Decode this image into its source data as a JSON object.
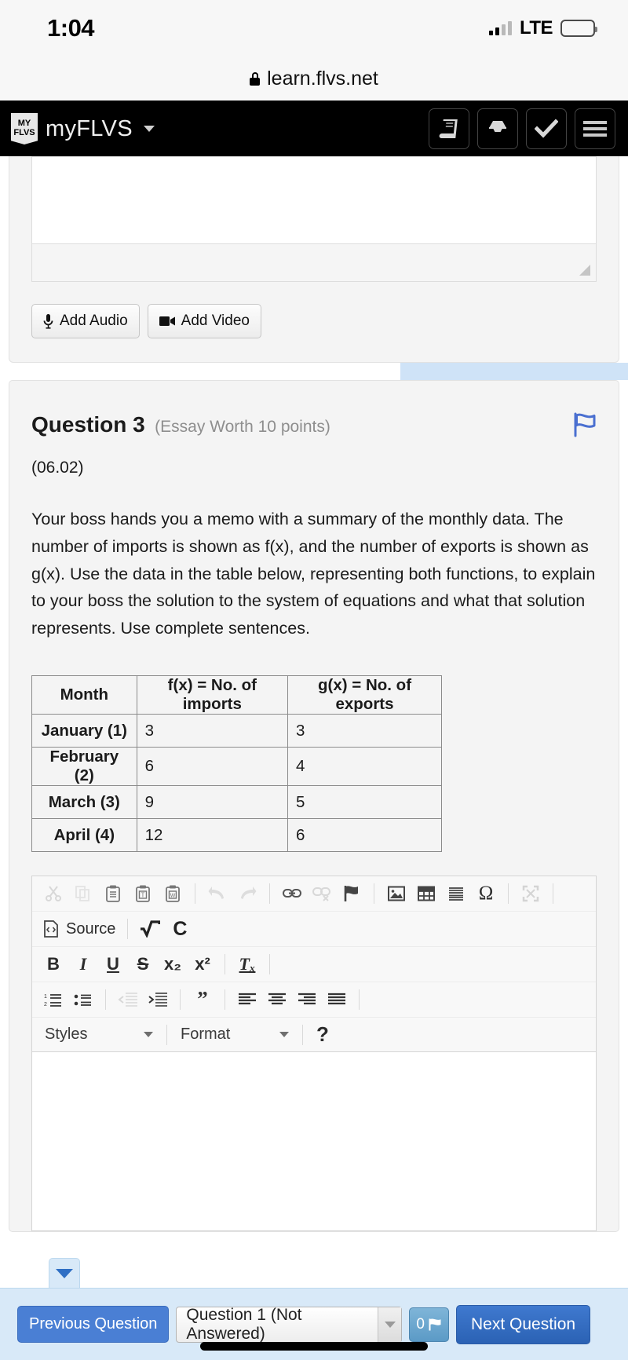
{
  "status_bar": {
    "time": "1:04",
    "network": "LTE",
    "signal_icon": "signal-bars-icon",
    "battery_icon": "battery-icon"
  },
  "browser": {
    "lock_icon": "lock-icon",
    "url": "learn.flvs.net"
  },
  "app_nav": {
    "logo_line1": "MY",
    "logo_line2": "FLVS",
    "brand": "myFLVS",
    "dropdown_icon": "chevron-down-icon",
    "icons": [
      {
        "name": "book-icon",
        "label": "Courses"
      },
      {
        "name": "inbox-icon",
        "label": "Messages"
      },
      {
        "name": "check-icon",
        "label": "Assignments"
      },
      {
        "name": "hamburger-menu-icon",
        "label": "Menu"
      }
    ]
  },
  "previous_question_card": {
    "answer_box_value": "",
    "add_audio_label": "Add Audio",
    "add_audio_icon": "microphone-icon",
    "add_video_label": "Add Video",
    "add_video_icon": "video-camera-icon",
    "resize_handle_icon": "resize-handle-icon"
  },
  "question": {
    "title": "Question 3",
    "worth": "(Essay Worth 10 points)",
    "code": "(06.02)",
    "flag_icon": "flag-icon",
    "prompt": "Your boss hands you a memo with a summary of the monthly data. The number of imports is shown as f(x), and the number of exports is shown as g(x). Use the data in the table below, representing both functions, to explain to your boss the solution to the system of equations and what that solution represents. Use complete sentences.",
    "table": {
      "headers": [
        "Month",
        "f(x) = No. of imports",
        "g(x) = No. of exports"
      ],
      "rows": [
        [
          "January (1)",
          "3",
          "3"
        ],
        [
          "February (2)",
          "6",
          "4"
        ],
        [
          "March (3)",
          "9",
          "5"
        ],
        [
          "April (4)",
          "12",
          "6"
        ]
      ]
    }
  },
  "editor": {
    "row1": [
      {
        "name": "cut-icon",
        "glyph": "✂",
        "state": "faded"
      },
      {
        "name": "copy-icon",
        "glyph": "❐",
        "state": "faded"
      },
      {
        "name": "paste-icon",
        "glyph": "ὌB",
        "state": "normal"
      },
      {
        "name": "paste-as-plain-text-icon",
        "glyph": "T",
        "state": "normal"
      },
      {
        "name": "paste-from-word-icon",
        "glyph": "W",
        "state": "normal"
      },
      {
        "name": "undo-icon",
        "glyph": "↶",
        "state": "faded"
      },
      {
        "name": "redo-icon",
        "glyph": "↷",
        "state": "faded"
      },
      {
        "name": "link-icon",
        "glyph": "ὑ7",
        "state": "normal"
      },
      {
        "name": "unlink-icon",
        "glyph": "ὑ7",
        "state": "faded"
      },
      {
        "name": "anchor-flag-icon",
        "glyph": "⚑",
        "state": "dark"
      },
      {
        "name": "image-icon",
        "glyph": "ὛC",
        "state": "dark"
      },
      {
        "name": "table-icon",
        "glyph": "▦",
        "state": "dark"
      },
      {
        "name": "horizontal-rule-icon",
        "glyph": "☰",
        "state": "dark"
      },
      {
        "name": "special-character-icon",
        "glyph": "Ω",
        "state": "dark"
      },
      {
        "name": "maximize-icon",
        "glyph": "⛶",
        "state": "faded"
      }
    ],
    "source_label": "Source",
    "source_icon": "source-code-icon",
    "equation_icon": "square-root-icon",
    "chemistry_icon": "chemistry-icon",
    "row3": [
      {
        "name": "bold-icon",
        "label": "B",
        "style": "bold"
      },
      {
        "name": "italic-icon",
        "label": "I",
        "style": "italic"
      },
      {
        "name": "underline-icon",
        "label": "U",
        "style": "underline"
      },
      {
        "name": "strikethrough-icon",
        "label": "S",
        "style": "strike"
      },
      {
        "name": "subscript-icon",
        "label": "x₂",
        "style": "plain"
      },
      {
        "name": "superscript-icon",
        "label": "x²",
        "style": "plain"
      },
      {
        "name": "remove-format-icon",
        "label": "Tₓ",
        "style": "plain"
      }
    ],
    "row4": [
      {
        "name": "numbered-list-icon",
        "state": "dark"
      },
      {
        "name": "bulleted-list-icon",
        "state": "dark"
      },
      {
        "name": "decrease-indent-icon",
        "state": "faded"
      },
      {
        "name": "increase-indent-icon",
        "state": "dark"
      },
      {
        "name": "blockquote-icon",
        "state": "dark"
      },
      {
        "name": "align-left-icon",
        "state": "dark"
      },
      {
        "name": "align-center-icon",
        "state": "dark"
      },
      {
        "name": "align-right-icon",
        "state": "dark"
      },
      {
        "name": "justify-icon",
        "state": "dark"
      }
    ],
    "styles_label": "Styles",
    "format_label": "Format",
    "help_label": "?",
    "body_value": ""
  },
  "bottom_nav": {
    "collapse_icon": "triangle-down-icon",
    "previous_label": "Previous Question",
    "question_select_value": "Question 1 (Not Answered)",
    "select_arrow_icon": "chevron-down-icon",
    "flag_count": "0",
    "flag_icon": "flag-icon",
    "next_label": "Next Question"
  },
  "colors": {
    "primary_blue": "#2b62b4",
    "light_blue_bar": "#d8e9f8",
    "nav_black": "#000000",
    "card_gray": "#f4f4f4"
  }
}
